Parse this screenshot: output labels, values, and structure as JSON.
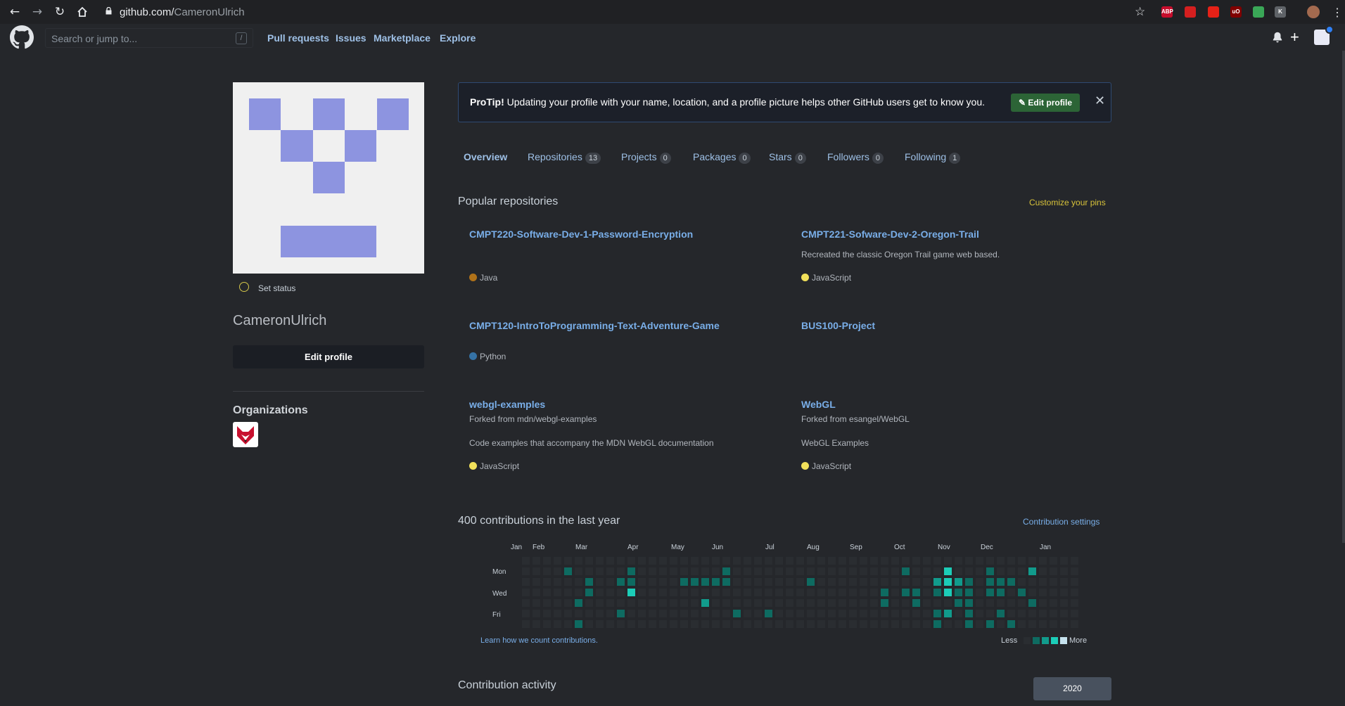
{
  "browser": {
    "url_host": "github.com/",
    "url_path": "CameronUlrich",
    "extensions": [
      {
        "name": "abp-icon",
        "label": "ABP",
        "color": "#c70d2c"
      },
      {
        "name": "stop-icon",
        "label": "",
        "color": "#d51f1f"
      },
      {
        "name": "youtube-icon",
        "label": "",
        "color": "#e62117"
      },
      {
        "name": "ublock-icon",
        "label": "uO",
        "color": "#800000"
      },
      {
        "name": "extension-icon",
        "label": "",
        "color": "#3aa757"
      },
      {
        "name": "k-icon",
        "label": "K",
        "color": "#5f6368"
      }
    ]
  },
  "header": {
    "search_placeholder": "Search or jump to...",
    "slash": "/",
    "nav": [
      "Pull requests",
      "Issues",
      "Marketplace",
      "Explore"
    ]
  },
  "sidebar": {
    "status": "Set status",
    "username": "CameronUlrich",
    "edit_label": "Edit profile",
    "org_title": "Organizations"
  },
  "protip": {
    "bold": "ProTip!",
    "text": "Updating your profile with your name, location, and a profile picture helps other GitHub users get to know you.",
    "button": "Edit profile",
    "close": "✕"
  },
  "tabs": [
    {
      "label": "Overview",
      "count": null
    },
    {
      "label": "Repositories",
      "count": "13"
    },
    {
      "label": "Projects",
      "count": "0"
    },
    {
      "label": "Packages",
      "count": "0"
    },
    {
      "label": "Stars",
      "count": "0"
    },
    {
      "label": "Followers",
      "count": "0"
    },
    {
      "label": "Following",
      "count": "1"
    }
  ],
  "popular": {
    "title": "Popular repositories",
    "customize": "Customize your pins",
    "repos": [
      {
        "name": "CMPT220-Software-Dev-1-Password-Encryption",
        "forked": "",
        "desc": "",
        "lang": "Java",
        "lang_color": "#b07219"
      },
      {
        "name": "CMPT221-Sofware-Dev-2-Oregon-Trail",
        "forked": "",
        "desc": "Recreated the classic Oregon Trail game web based.",
        "lang": "JavaScript",
        "lang_color": "#f1e05a"
      },
      {
        "name": "CMPT120-IntroToProgramming-Text-Adventure-Game",
        "forked": "",
        "desc": "",
        "lang": "Python",
        "lang_color": "#3572A5"
      },
      {
        "name": "BUS100-Project",
        "forked": "",
        "desc": "",
        "lang": "",
        "lang_color": ""
      },
      {
        "name": "webgl-examples",
        "forked": "Forked from mdn/webgl-examples",
        "desc": "Code examples that accompany the MDN WebGL documentation",
        "lang": "JavaScript",
        "lang_color": "#f1e05a"
      },
      {
        "name": "WebGL",
        "forked": "Forked from esangel/WebGL",
        "desc": "WebGL Examples",
        "lang": "JavaScript",
        "lang_color": "#f1e05a"
      }
    ]
  },
  "contributions": {
    "title": "400 contributions in the last year",
    "settings": "Contribution settings",
    "months": [
      "Jan",
      "Feb",
      "Mar",
      "Apr",
      "May",
      "Jun",
      "Jul",
      "Aug",
      "Sep",
      "Oct",
      "Nov",
      "Dec",
      "Jan"
    ],
    "weekdays": [
      "Mon",
      "Wed",
      "Fri"
    ],
    "learn": "Learn how we count contributions.",
    "less": "Less",
    "more": "More",
    "colors": [
      "#2a2d31",
      "#0e6b61",
      "#119b8c",
      "#1ccdb8",
      "#c6e2ee"
    ],
    "active_cells": [
      [
        4,
        1,
        1
      ],
      [
        10,
        1,
        1
      ],
      [
        19,
        1,
        1
      ],
      [
        36,
        1,
        1
      ],
      [
        40,
        1,
        3
      ],
      [
        44,
        1,
        1
      ],
      [
        48,
        1,
        2
      ],
      [
        6,
        2,
        1
      ],
      [
        9,
        2,
        1
      ],
      [
        10,
        2,
        1
      ],
      [
        15,
        2,
        1
      ],
      [
        16,
        2,
        1
      ],
      [
        17,
        2,
        1
      ],
      [
        18,
        2,
        1
      ],
      [
        19,
        2,
        1
      ],
      [
        27,
        2,
        1
      ],
      [
        39,
        2,
        2
      ],
      [
        40,
        2,
        3
      ],
      [
        41,
        2,
        2
      ],
      [
        42,
        2,
        1
      ],
      [
        44,
        2,
        1
      ],
      [
        45,
        2,
        1
      ],
      [
        46,
        2,
        1
      ],
      [
        6,
        3,
        1
      ],
      [
        10,
        3,
        3
      ],
      [
        34,
        3,
        1
      ],
      [
        36,
        3,
        1
      ],
      [
        37,
        3,
        1
      ],
      [
        39,
        3,
        1
      ],
      [
        40,
        3,
        3
      ],
      [
        41,
        3,
        1
      ],
      [
        42,
        3,
        1
      ],
      [
        44,
        3,
        1
      ],
      [
        45,
        3,
        1
      ],
      [
        47,
        3,
        1
      ],
      [
        5,
        4,
        1
      ],
      [
        17,
        4,
        2
      ],
      [
        34,
        4,
        1
      ],
      [
        37,
        4,
        1
      ],
      [
        41,
        4,
        1
      ],
      [
        42,
        4,
        1
      ],
      [
        48,
        4,
        1
      ],
      [
        9,
        5,
        1
      ],
      [
        20,
        5,
        1
      ],
      [
        23,
        5,
        1
      ],
      [
        39,
        5,
        1
      ],
      [
        40,
        5,
        2
      ],
      [
        42,
        5,
        1
      ],
      [
        45,
        5,
        1
      ],
      [
        5,
        6,
        1
      ],
      [
        39,
        6,
        1
      ],
      [
        42,
        6,
        1
      ],
      [
        44,
        6,
        1
      ],
      [
        46,
        6,
        1
      ],
      [
        4,
        7,
        2
      ],
      [
        17,
        7,
        1
      ],
      [
        20,
        7,
        1
      ],
      [
        39,
        7,
        1
      ],
      [
        42,
        7,
        4
      ],
      [
        44,
        7,
        1
      ],
      [
        45,
        7,
        1
      ],
      [
        47,
        7,
        4
      ]
    ]
  },
  "activity": {
    "title": "Contribution activity",
    "year": "2020"
  }
}
